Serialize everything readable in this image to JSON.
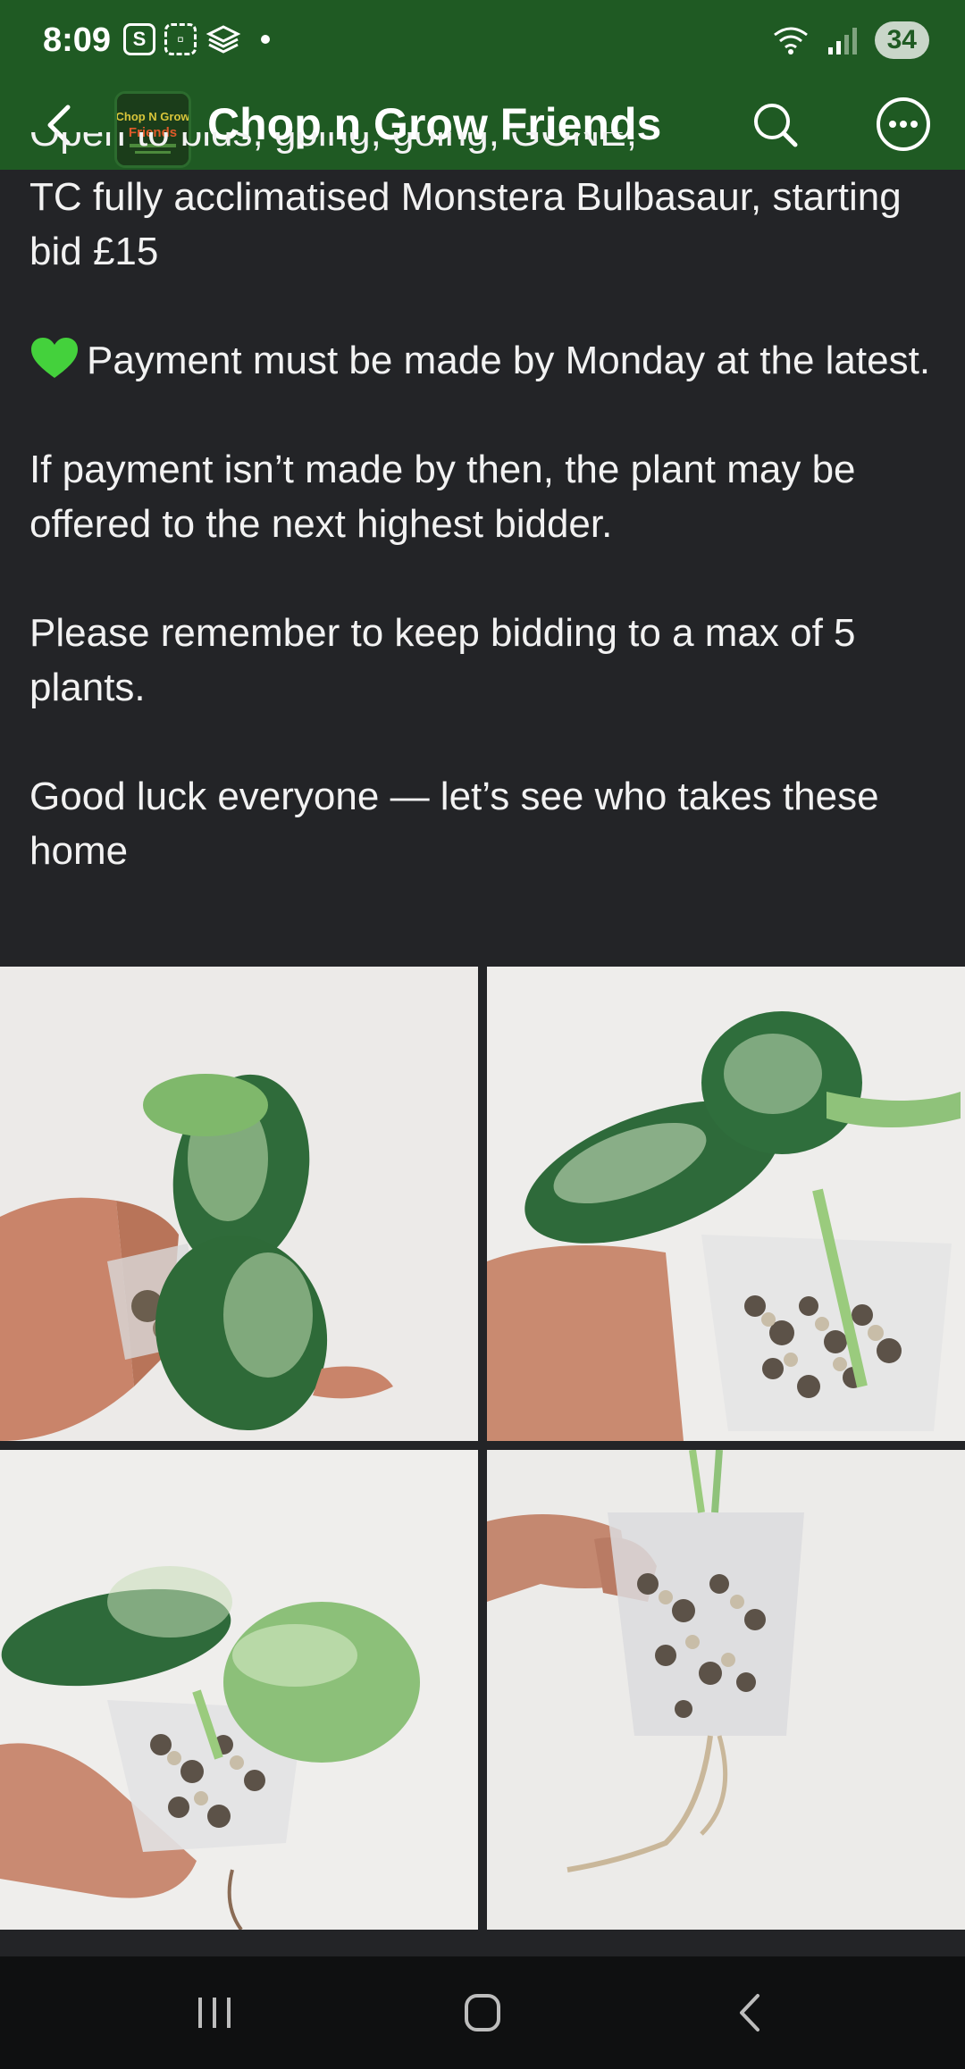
{
  "status_bar": {
    "time": "8:09",
    "battery": "34",
    "icons": [
      "s-app-icon",
      "screenshot-icon",
      "layers-icon",
      "wifi-icon",
      "signal-icon"
    ]
  },
  "app_bar": {
    "title": "Chop n Grow Friends",
    "logo_text": "Chop N Grow Friends",
    "icons": [
      "back-arrow-icon",
      "search-icon",
      "more-icon"
    ]
  },
  "post": {
    "cut_line": "Open to bids, going, going, GONE,",
    "line1": "TC fully acclimatised Monstera Bulbasaur, starting bid £15",
    "payment": "Payment must be made by Monday at the latest.",
    "offer": "If payment isn’t made by then, the plant may be offered to the next highest bidder.",
    "reminder": "Please remember to keep bidding to a max of 5 plants.",
    "goodluck": "Good luck everyone — let’s see who takes these home"
  },
  "photos": [
    "plant-photo-1",
    "plant-photo-2",
    "plant-photo-3",
    "plant-photo-4"
  ],
  "nav": [
    "recent-apps-icon",
    "home-icon",
    "back-icon"
  ],
  "colors": {
    "header_green": "#1f5a23",
    "background": "#232427",
    "heart": "#44d13c"
  }
}
